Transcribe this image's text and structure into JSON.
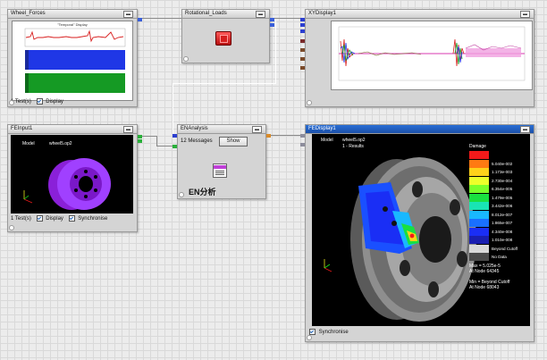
{
  "nodes": {
    "wheel_forces": {
      "title": "Wheel_Forces",
      "plot_title": "\"Temporal\" Display",
      "trace_colors": {
        "red": "#d81e1e",
        "blue": "#1f37e6",
        "green": "#159a24"
      },
      "tests": "1 Test(s)",
      "display_label": "Display"
    },
    "rotational_loads": {
      "title": "Rotational_Loads"
    },
    "xy_display": {
      "title": "XYDisplay1"
    },
    "fe_input": {
      "title": "FEInput1",
      "model_label": "Model",
      "model_value": "wheel5.op2",
      "tests": "1 Test(s)",
      "display_label": "Display",
      "sync_label": "Synchronise"
    },
    "en_analysis": {
      "title": "ENAnalysis",
      "messages": "12 Messages",
      "show_button": "Show",
      "caption": "EN分析"
    },
    "fe_display": {
      "title": "FEDisplay1",
      "model_label": "Model",
      "model_value": "wheel5.op2",
      "results": "1 - Results",
      "legend_title": "Damage",
      "legend": [
        {
          "color": "#f21a1a",
          "label": ""
        },
        {
          "color": "#ff7a12",
          "label": "5.040e-002"
        },
        {
          "color": "#ffd21a",
          "label": "1.173e-003"
        },
        {
          "color": "#ecff2a",
          "label": "2.730e-004"
        },
        {
          "color": "#79ff2a",
          "label": "6.354e-005"
        },
        {
          "color": "#19e040",
          "label": "1.479e-005"
        },
        {
          "color": "#19e4b4",
          "label": "3.442e-006"
        },
        {
          "color": "#19b8ff",
          "label": "8.012e-007"
        },
        {
          "color": "#1970ff",
          "label": "1.865e-007"
        },
        {
          "color": "#1a2ef5",
          "label": "4.340e-008"
        },
        {
          "color": "#1a1fb0",
          "label": "1.010e-008"
        },
        {
          "color": "#d9d9d9",
          "label": "Beyond Cutoff"
        },
        {
          "color": "#4a4a4a",
          "label": "No Data"
        }
      ],
      "max_line": "Max = 5.025e-5",
      "max_node": "At Node 64345",
      "min_line": "Min = Beyond Cutoff",
      "min_node": "At Node 68043",
      "sync_label": "Synchronise"
    }
  }
}
